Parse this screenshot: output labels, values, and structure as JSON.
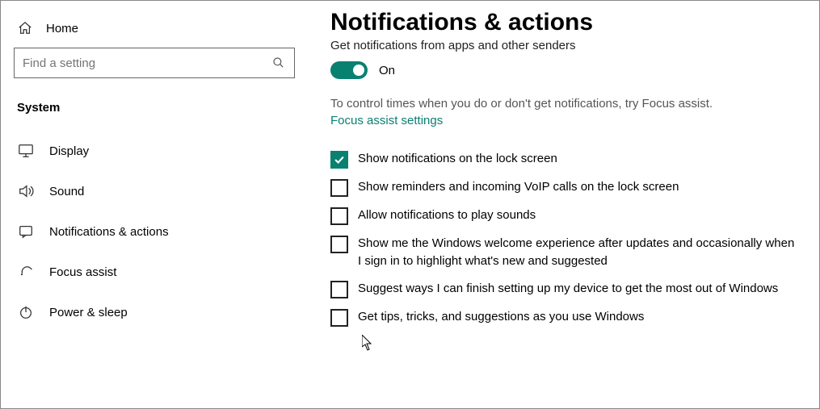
{
  "sidebar": {
    "home": "Home",
    "search_placeholder": "Find a setting",
    "category": "System",
    "items": [
      {
        "label": "Display"
      },
      {
        "label": "Sound"
      },
      {
        "label": "Notifications & actions"
      },
      {
        "label": "Focus assist"
      },
      {
        "label": "Power & sleep"
      }
    ]
  },
  "main": {
    "title": "Notifications & actions",
    "subheading": "Get notifications from apps and other senders",
    "toggle_state": "On",
    "help_text": "To control times when you do or don't get notifications, try Focus assist.",
    "focus_link": "Focus assist settings",
    "checkboxes": [
      {
        "label": "Show notifications on the lock screen",
        "checked": true
      },
      {
        "label": "Show reminders and incoming VoIP calls on the lock screen",
        "checked": false
      },
      {
        "label": "Allow notifications to play sounds",
        "checked": false
      },
      {
        "label": "Show me the Windows welcome experience after updates and occasionally when I sign in to highlight what's new and suggested",
        "checked": false
      },
      {
        "label": "Suggest ways I can finish setting up my device to get the most out of Windows",
        "checked": false
      },
      {
        "label": "Get tips, tricks, and suggestions as you use Windows",
        "checked": false
      }
    ]
  }
}
